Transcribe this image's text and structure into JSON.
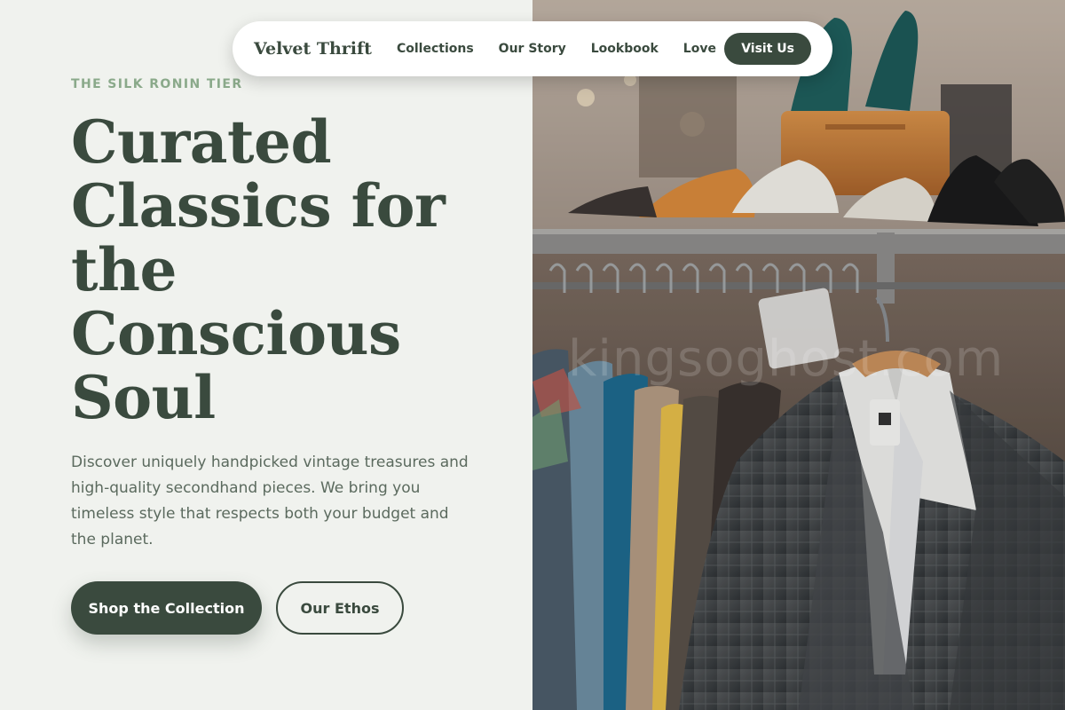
{
  "nav": {
    "brand": "Velvet Thrift",
    "links": [
      "Collections",
      "Our Story",
      "Lookbook",
      "Love"
    ],
    "cta": "Visit Us"
  },
  "hero": {
    "eyebrow": "THE SILK RONIN TIER",
    "headline": "Curated Classics for the Conscious Soul",
    "description": "Discover uniquely handpicked vintage treasures and high-quality secondhand pieces. We bring you timeless style that respects both your budget and the planet.",
    "primary_button": "Shop the Collection",
    "secondary_button": "Our Ethos"
  },
  "image": {
    "subject": "thrift store clothing rack with shoes on shelf",
    "watermark": "kingsoghost.com"
  },
  "colors": {
    "background": "#f0f2ee",
    "primary": "#3a4a3e",
    "accent": "#8aa98a",
    "text_muted": "#5b6a5e"
  }
}
